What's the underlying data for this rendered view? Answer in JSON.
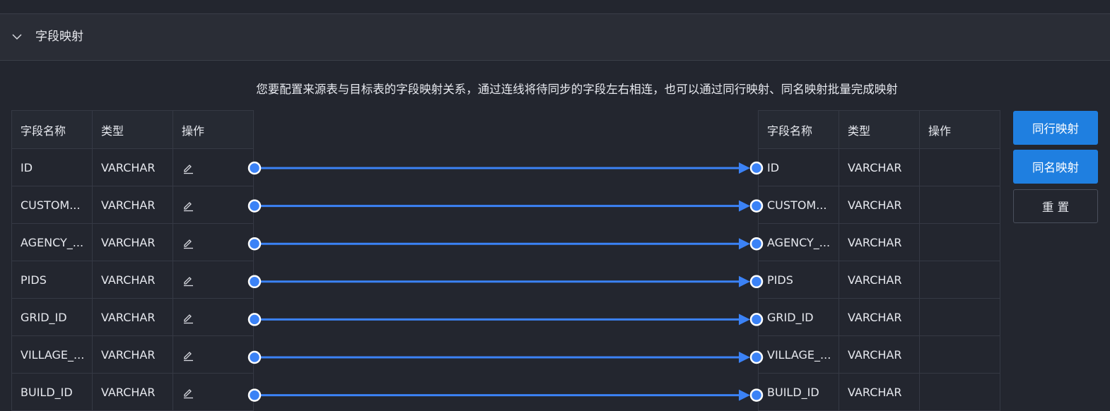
{
  "section": {
    "title": "字段映射"
  },
  "hint": "您要配置来源表与目标表的字段映射关系，通过连线将待同步的字段左右相连，也可以通过同行映射、同名映射批量完成映射",
  "left_table": {
    "headers": [
      "字段名称",
      "类型",
      "操作"
    ],
    "rows": [
      {
        "name": "ID",
        "type": "VARCHAR"
      },
      {
        "name": "CUSTOM...",
        "type": "VARCHAR"
      },
      {
        "name": "AGENCY_...",
        "type": "VARCHAR"
      },
      {
        "name": "PIDS",
        "type": "VARCHAR"
      },
      {
        "name": "GRID_ID",
        "type": "VARCHAR"
      },
      {
        "name": "VILLAGE_...",
        "type": "VARCHAR"
      },
      {
        "name": "BUILD_ID",
        "type": "VARCHAR"
      }
    ]
  },
  "right_table": {
    "headers": [
      "字段名称",
      "类型",
      "操作"
    ],
    "rows": [
      {
        "name": "ID",
        "type": "VARCHAR"
      },
      {
        "name": "CUSTOM...",
        "type": "VARCHAR"
      },
      {
        "name": "AGENCY_...",
        "type": "VARCHAR"
      },
      {
        "name": "PIDS",
        "type": "VARCHAR"
      },
      {
        "name": "GRID_ID",
        "type": "VARCHAR"
      },
      {
        "name": "VILLAGE_...",
        "type": "VARCHAR"
      },
      {
        "name": "BUILD_ID",
        "type": "VARCHAR"
      }
    ]
  },
  "buttons": {
    "row_mapping": "同行映射",
    "name_mapping": "同名映射",
    "reset": "重 置"
  },
  "colors": {
    "accent": "#1f7fe0",
    "link_line": "#3b82f6"
  },
  "icons": {
    "collapse": "chevron-down-icon",
    "edit": "edit-icon"
  }
}
